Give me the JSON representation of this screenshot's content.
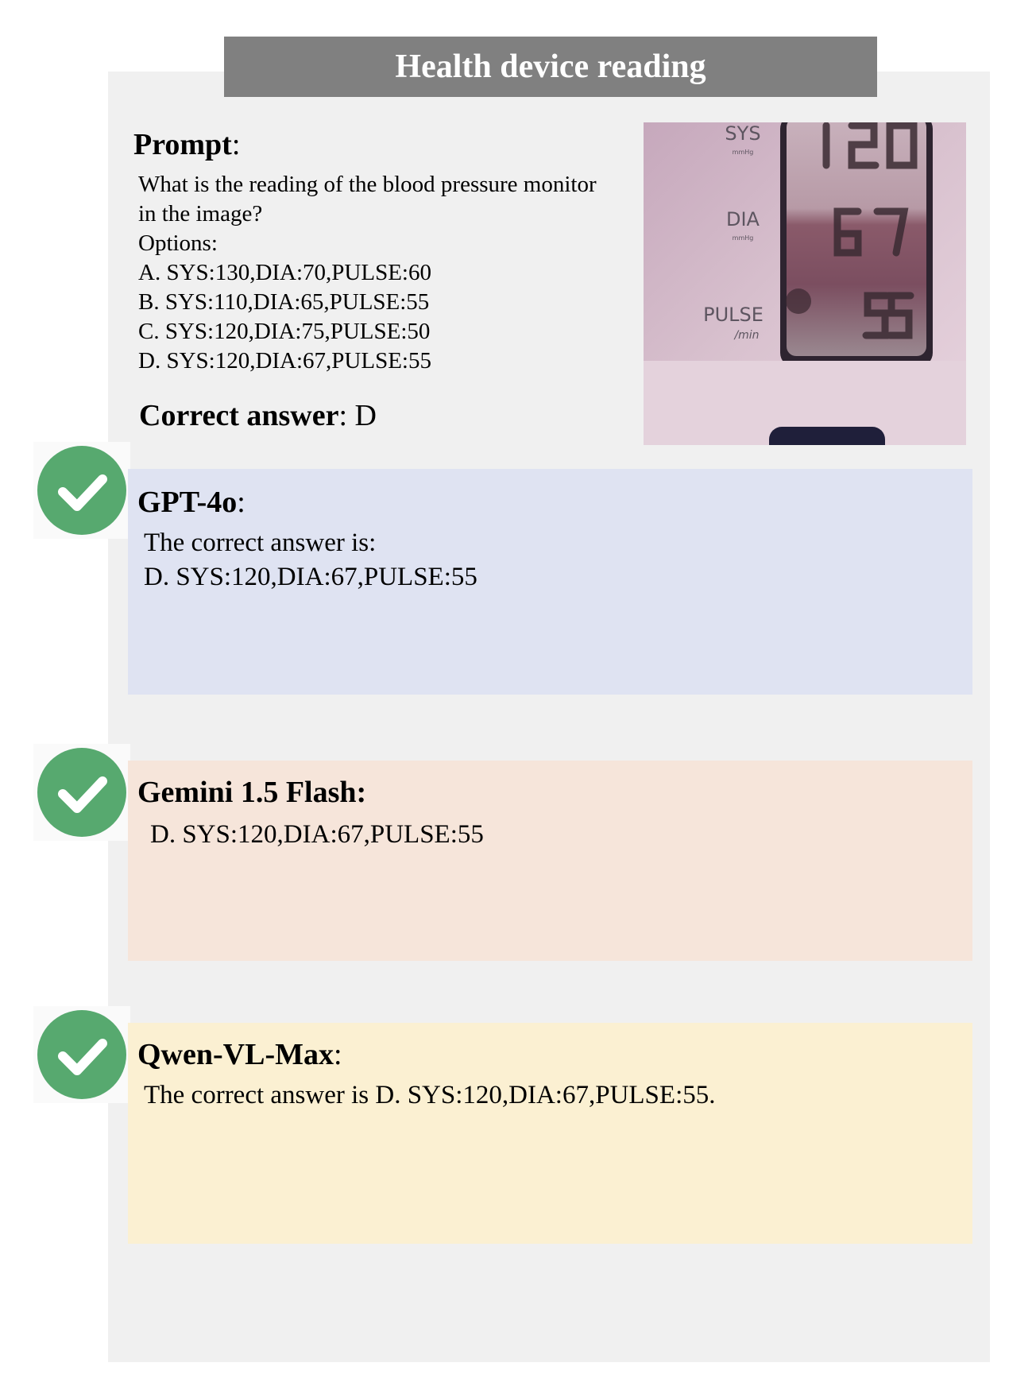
{
  "title": "Health device reading",
  "prompt": {
    "label": "Prompt",
    "colon": ":",
    "question_line1": "What is the reading of the blood pressure monitor",
    "question_line2": "in the image?",
    "options_label": "Options:",
    "options": [
      "A. SYS:130,DIA:70,PULSE:60",
      "B. SYS:110,DIA:65,PULSE:55",
      "C. SYS:120,DIA:75,PULSE:50",
      "D. SYS:120,DIA:67,PULSE:55"
    ]
  },
  "correct_answer": {
    "label": "Correct answer",
    "colon": ":",
    "value": " D"
  },
  "monitor_image": {
    "labels": {
      "sys": "SYS",
      "sys_unit": "mmHg",
      "dia": "DIA",
      "dia_unit": "mmHg",
      "pulse": "PULSE",
      "pulse_unit": "/min"
    },
    "readings": {
      "sys": "120",
      "dia": "67",
      "pulse": "55"
    }
  },
  "responses": [
    {
      "model": "GPT-4o",
      "colon": ":",
      "lines": [
        "The correct answer is:",
        "D. SYS:120,DIA:67,PULSE:55"
      ],
      "result_icon": "check-icon",
      "color": "#dfe3f2"
    },
    {
      "model": "Gemini 1.5 Flash:",
      "colon": "",
      "lines": [
        "D. SYS:120,DIA:67,PULSE:55"
      ],
      "result_icon": "check-icon",
      "color": "#f6e5da"
    },
    {
      "model": "Qwen-VL-Max",
      "colon": ":",
      "lines": [
        "The correct answer is D. SYS:120,DIA:67,PULSE:55."
      ],
      "result_icon": "check-icon",
      "color": "#fbf0d2"
    }
  ],
  "colors": {
    "panel": "#f0f0f0",
    "title_bar": "#808080",
    "check": "#57a96f"
  }
}
